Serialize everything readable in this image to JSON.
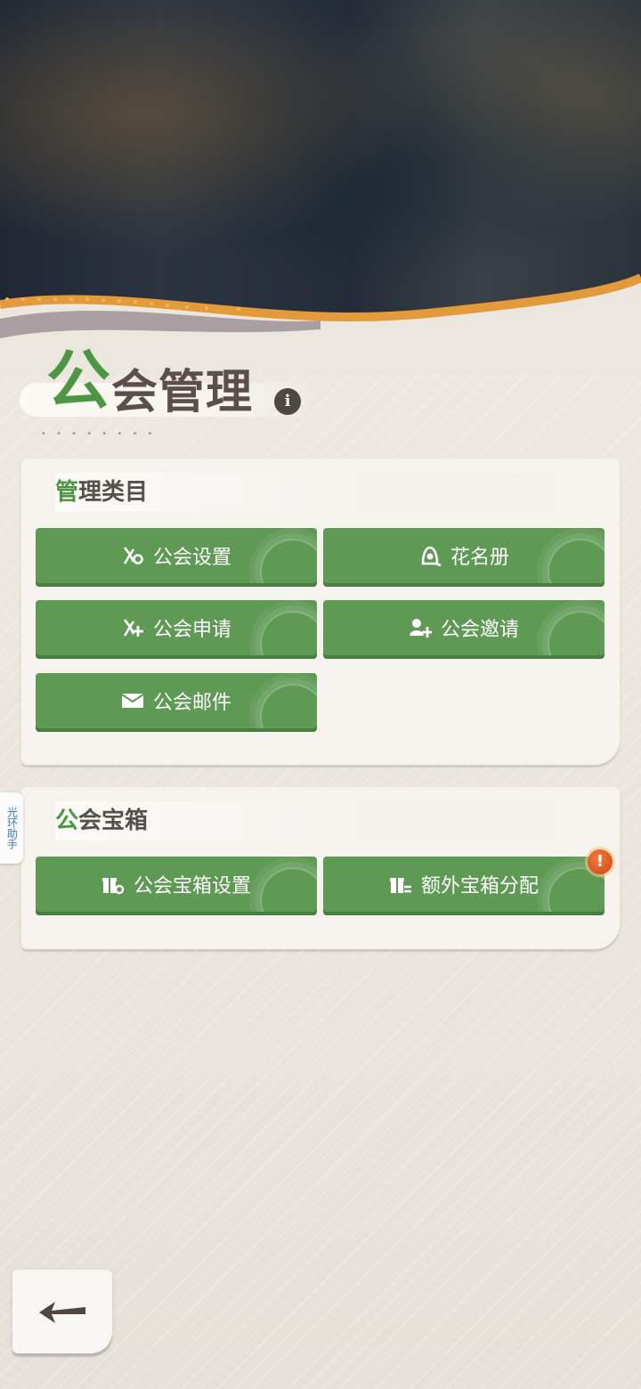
{
  "page": {
    "title_first_char": "公",
    "title_rest": "会管理",
    "info_icon_text": "i",
    "title_dots": "• • • • • • • •"
  },
  "management_panel": {
    "header_first_char": "管",
    "header_rest": "理类目",
    "buttons": [
      {
        "label": "公会设置",
        "icon": "guild-settings-icon"
      },
      {
        "label": "花名册",
        "icon": "roster-icon"
      },
      {
        "label": "公会申请",
        "icon": "guild-application-icon"
      },
      {
        "label": "公会邀请",
        "icon": "guild-invite-icon"
      },
      {
        "label": "公会邮件",
        "icon": "mail-icon"
      }
    ]
  },
  "chest_panel": {
    "header_first_char": "公",
    "header_rest": "会宝箱",
    "buttons": [
      {
        "label": "公会宝箱设置",
        "icon": "chest-settings-icon"
      },
      {
        "label": "额外宝箱分配",
        "icon": "chest-distribute-icon"
      }
    ],
    "alert_badge": "!"
  },
  "side_tab": {
    "label": "光环助手"
  },
  "colors": {
    "accent_green": "#5f9a55",
    "title_green": "#4e9546",
    "alert_orange": "#e0572a"
  }
}
